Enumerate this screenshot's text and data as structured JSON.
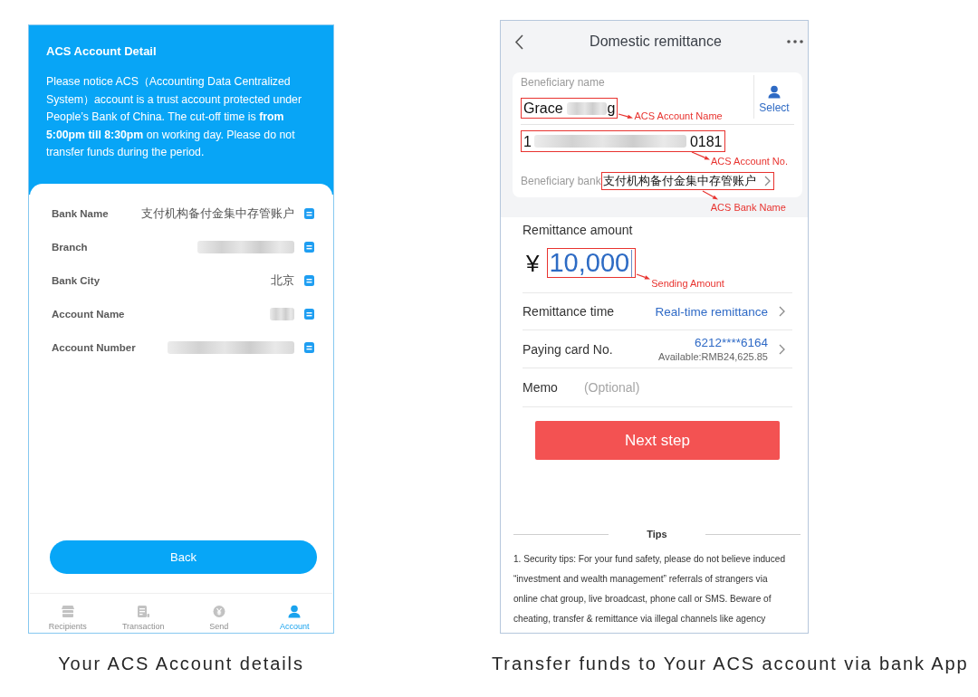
{
  "account_screen": {
    "title": "ACS Account Detail",
    "notice": "Please notice ACS（Accounting Data Centralized System）account is a trust account protected under People’s Bank of China. The cut-off time is **from 5:00pm till 8:30pm** on working day. Please do not transfer funds during the period.",
    "fields": [
      {
        "label": "Bank Name",
        "value": "支付机构备付金集中存管账户",
        "redacted": false
      },
      {
        "label": "Branch",
        "redacted": true
      },
      {
        "label": "Bank City",
        "value": "北京",
        "redacted": false
      },
      {
        "label": "Account Name",
        "redacted": true
      },
      {
        "label": "Account Number",
        "redacted": true
      }
    ],
    "back_button": "Back",
    "tab_bar": [
      {
        "label": "Recipients",
        "selected": false
      },
      {
        "label": "Transaction",
        "selected": false
      },
      {
        "label": "Send",
        "selected": false
      },
      {
        "label": "Account",
        "selected": true
      }
    ]
  },
  "remittance_screen": {
    "title": "Domestic remittance",
    "beneficiary": {
      "name_label": "Beneficiary name",
      "name_start": "Grace",
      "name_end": "g",
      "name_annotation": "ACS Account Name",
      "select": "Select",
      "account_start": "1",
      "account_end": "0181",
      "account_annotation": "ACS Account No.",
      "bank_label": "Beneficiary bank",
      "bank": "支付机构备付金集中存管账户",
      "bank_annotation": "ACS Bank Name"
    },
    "amount": {
      "label": "Remittance amount",
      "currency": "¥",
      "value": "10,000",
      "annotation": "Sending Amount"
    },
    "rows": [
      {
        "kind": "option",
        "label": "Remittance time",
        "value": "Real-time remittance"
      },
      {
        "kind": "card",
        "label": "Paying card No.",
        "value": "6212****6164",
        "detail": "Available:RMB24,625.85"
      },
      {
        "kind": "input",
        "label": "Memo",
        "placeholder": "(Optional)"
      }
    ],
    "next_button": "Next step",
    "tips": {
      "title": "Tips",
      "text": "1. Security tips: For your fund safety, please do not believe induced “investment and wealth management” referrals of strangers via online chat group, live broadcast, phone call or SMS. Beware of cheating, transfer & remittance via illegal channels like agency"
    }
  },
  "captions": [
    "Your ACS Account details",
    "Transfer funds to Your ACS account via bank App"
  ]
}
